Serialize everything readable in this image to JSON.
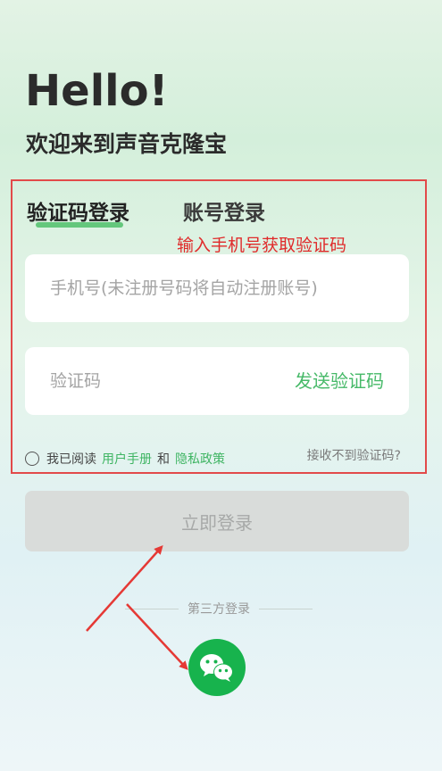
{
  "header": {
    "greeting": "Hello!",
    "welcome": "欢迎来到声音克隆宝"
  },
  "tabs": [
    {
      "label": "验证码登录",
      "active": true
    },
    {
      "label": "账号登录",
      "active": false
    }
  ],
  "annotation": {
    "text": "输入手机号获取验证码",
    "color": "#e02a2a"
  },
  "form": {
    "phone_placeholder": "手机号(未注册号码将自动注册账号)",
    "code_placeholder": "验证码",
    "send_code_label": "发送验证码"
  },
  "agreement": {
    "prefix": "我已阅读",
    "user_manual": "用户手册",
    "and": "和",
    "privacy": "隐私政策",
    "no_code": "接收不到验证码?"
  },
  "login_button": "立即登录",
  "third_party": {
    "label": "第三方登录",
    "wechat_icon": "wechat-icon"
  },
  "colors": {
    "accent": "#46b968",
    "wechat": "#17b34d",
    "annotation": "#e24a4a"
  }
}
